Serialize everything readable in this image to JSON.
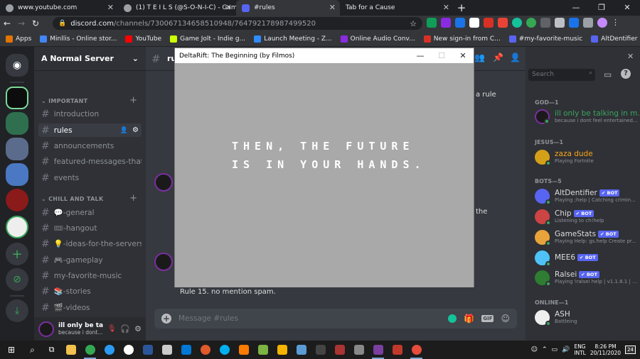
{
  "browser": {
    "tabs": [
      {
        "title": "www.youtube.com",
        "color": "#e8eaed",
        "active": false
      },
      {
        "title": "(1) T E I L S (@S-O-N-I-C) - Game",
        "color": "#9aa0a6",
        "active": false
      },
      {
        "title": "#rules",
        "color": "#5865f2",
        "active": true
      },
      {
        "title": "Tab for a Cause",
        "color": "#35363a",
        "active": false
      }
    ],
    "url_host": "discord.com",
    "url_path": "/channels/730067134658510948/764792178987499520",
    "bookmarks": [
      {
        "label": "Apps",
        "color": "#e37400"
      },
      {
        "label": "Minllis - Online stor...",
        "color": "#4285f4"
      },
      {
        "label": "YouTube",
        "color": "#ff0000"
      },
      {
        "label": "Game Jolt - Indie g...",
        "color": "#ccff00"
      },
      {
        "label": "Launch Meeting - Z...",
        "color": "#2d8cff"
      },
      {
        "label": "Online Audio Conv...",
        "color": "#8a2be2"
      },
      {
        "label": "New sign-in from C...",
        "color": "#d93025"
      },
      {
        "label": "#my-favorite-music",
        "color": "#5865f2"
      },
      {
        "label": "AltDentifier | Discor...",
        "color": "#5865f2"
      }
    ]
  },
  "discord": {
    "server_name": "A Normal Server",
    "categories": {
      "important": "IMPORTANT",
      "chill": "CHILL AND TALK"
    },
    "channels_important": [
      "introduction",
      "rules",
      "announcements",
      "featured-messages-that-...",
      "events"
    ],
    "channels_chill": [
      "💬-general",
      "🎟-hangout",
      "💡-ideas-for-the-servers",
      "🎮-gameplay",
      "my-favorite-music",
      "📚-stories",
      "🎬-videos"
    ],
    "header_channel": "ru",
    "search_placeholder": "Search",
    "message_partial_1": "a rule",
    "message_partial_2": "the",
    "message_last": "Rule 15. no mention spam.",
    "input_placeholder": "Message #rules",
    "user": {
      "name": "ill only be ta...",
      "status": "because i dont..."
    },
    "member_groups": [
      {
        "label": "GOD—1",
        "members": [
          {
            "name": "ill only be talking in m...",
            "status": "because i dont feel entertained...",
            "color": "#3ba55d",
            "bot": false
          }
        ]
      },
      {
        "label": "JESUS—1",
        "members": [
          {
            "name": "zaza dude",
            "status": "Playing Fortnite",
            "color": "#faa61a",
            "bot": false
          }
        ]
      },
      {
        "label": "BOTS—5",
        "members": [
          {
            "name": "AltDentifier",
            "status": "Playing ;help | Catching crimin...",
            "color": "#b9bbbe",
            "bot": true
          },
          {
            "name": "Chip",
            "status": "Listening to ch!help",
            "color": "#b9bbbe",
            "bot": true
          },
          {
            "name": "GameStats",
            "status": "Playing Help: gs.help Create pr...",
            "color": "#b9bbbe",
            "bot": true
          },
          {
            "name": "MEE6",
            "status": "",
            "color": "#b9bbbe",
            "bot": true
          },
          {
            "name": "Ralsei",
            "status": "Playing !ralsei help | v1.1.8.1 | S...",
            "color": "#b9bbbe",
            "bot": true
          }
        ]
      },
      {
        "label": "ONLINE—1",
        "members": [
          {
            "name": "ASH",
            "status": "Battleing",
            "color": "#b9bbbe",
            "bot": false
          }
        ]
      }
    ],
    "bot_label": "✔ BOT"
  },
  "game": {
    "title": "DeltaRift: The Beginning (by Filmos)",
    "line1": "THEN, THE FUTURE",
    "line2": "IS IN YOUR HANDS."
  },
  "taskbar": {
    "lang": "ENG",
    "layout": "INTL",
    "time": "8:26 PM",
    "date": "20/11/2020",
    "notifications": "24"
  }
}
